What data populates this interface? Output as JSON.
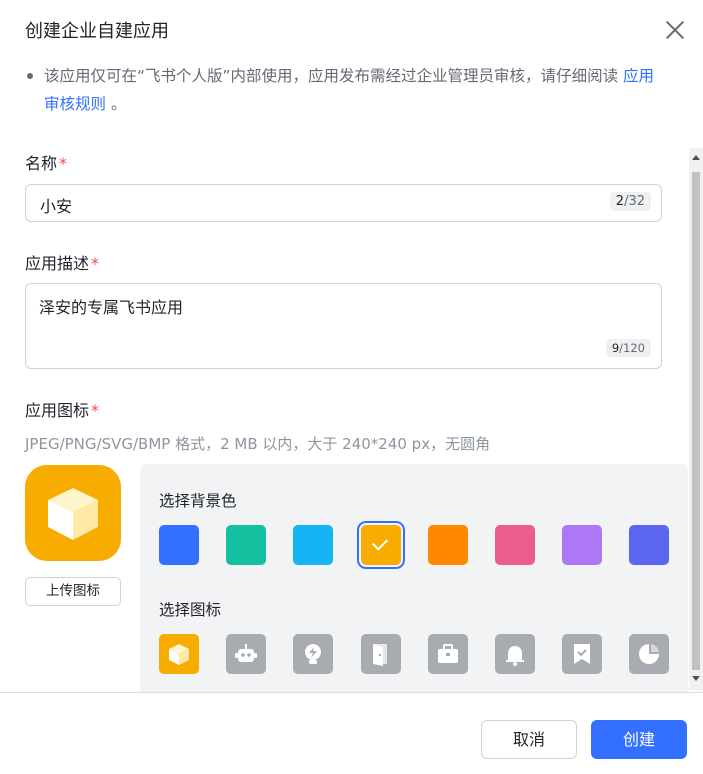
{
  "dialog": {
    "title": "创建企业自建应用",
    "notice_prefix": "该应用仅可在“飞书个人版”内部使用，应用发布需经过企业管理员审核，请仔细阅读",
    "notice_link": "应用审核规则",
    "notice_suffix": "。"
  },
  "form": {
    "name": {
      "label": "名称",
      "required_mark": "*",
      "value": "小安",
      "count_current": "2",
      "count_max": "/32"
    },
    "description": {
      "label": "应用描述",
      "required_mark": "*",
      "value": "泽安的专属飞书应用",
      "count_current": "9",
      "count_max": "/120"
    },
    "icon": {
      "label": "应用图标",
      "required_mark": "*",
      "hint": "JPEG/PNG/SVG/BMP 格式，2 MB 以内，大于 240*240 px，无圆角",
      "upload_label": "上传图标",
      "preview_color": "#f9ac00"
    }
  },
  "picker": {
    "bg_label": "选择背景色",
    "colors": [
      {
        "name": "blue",
        "hex": "#3370ff"
      },
      {
        "name": "teal",
        "hex": "#14c0a0"
      },
      {
        "name": "cyan",
        "hex": "#14b4f5"
      },
      {
        "name": "yellow",
        "hex": "#f9ac00",
        "selected": true
      },
      {
        "name": "orange",
        "hex": "#ff8800"
      },
      {
        "name": "pink",
        "hex": "#eb5c8f"
      },
      {
        "name": "purple",
        "hex": "#ad78f5"
      },
      {
        "name": "indigo",
        "hex": "#5b65f0"
      }
    ],
    "icon_label": "选择图标",
    "icons": [
      "cube-icon",
      "robot-icon",
      "lightbulb-icon",
      "door-icon",
      "briefcase-icon",
      "bell-icon",
      "bookmark-check-icon",
      "pie-chart-icon"
    ]
  },
  "footer": {
    "cancel_label": "取消",
    "create_label": "创建"
  }
}
